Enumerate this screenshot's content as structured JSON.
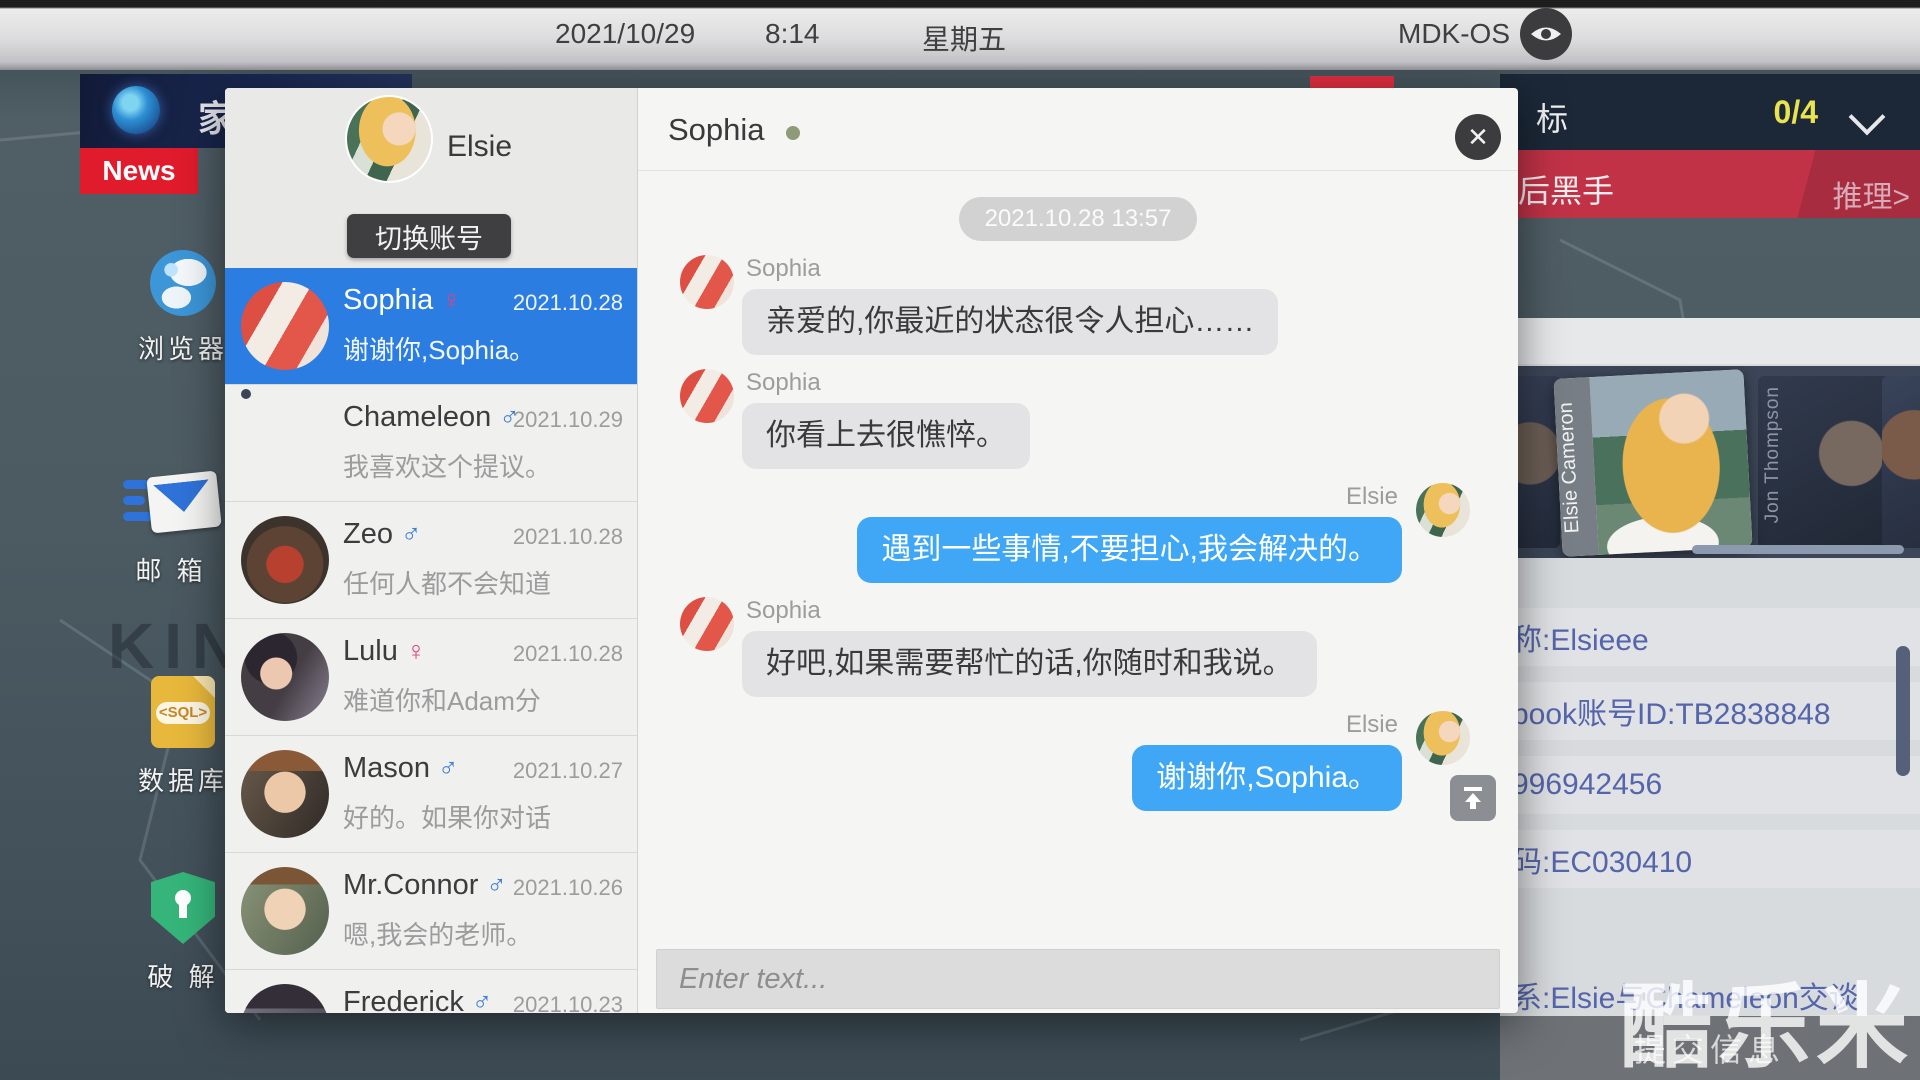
{
  "topbar": {
    "date": "2021/10/29",
    "time": "8:14",
    "weekday": "星期五",
    "os_name": "MDK-OS"
  },
  "desktop": {
    "news_widget": {
      "headline": "家",
      "badge": "News"
    },
    "wallpaper_text": "KIN S",
    "icons": [
      {
        "id": "browser",
        "label": "浏览器"
      },
      {
        "id": "mail",
        "label": "邮 箱"
      },
      {
        "id": "database",
        "label": "数据库",
        "badge": "<SQL>"
      },
      {
        "id": "crack",
        "label": "破 解"
      }
    ]
  },
  "messenger": {
    "account": {
      "name": "Elsie",
      "switch_button": "切换账号"
    },
    "contacts": [
      {
        "name": "Sophia",
        "gender": "♀",
        "date": "2021.10.28",
        "preview": "谢谢你,Sophia。"
      },
      {
        "name": "Chameleon",
        "gender": "♂",
        "date": "2021.10.29",
        "preview": "我喜欢这个提议。"
      },
      {
        "name": "Zeo",
        "gender": "♂",
        "date": "2021.10.28",
        "preview": "任何人都不会知道"
      },
      {
        "name": "Lulu",
        "gender": "♀",
        "date": "2021.10.28",
        "preview": "难道你和Adam分"
      },
      {
        "name": "Mason",
        "gender": "♂",
        "date": "2021.10.27",
        "preview": "好的。如果你对话"
      },
      {
        "name": "Mr.Connor",
        "gender": "♂",
        "date": "2021.10.26",
        "preview": "嗯,我会的老师。"
      },
      {
        "name": "Frederick",
        "gender": "♂",
        "date": "2021.10.23",
        "preview": ""
      }
    ],
    "chat": {
      "title": "Sophia",
      "timestamp": "2021.10.28 13:57",
      "messages": [
        {
          "from": "Sophia",
          "text": "亲爱的,你最近的状态很令人担心……"
        },
        {
          "from": "Sophia",
          "text": "你看上去很憔悴。"
        },
        {
          "from": "Elsie",
          "text": "遇到一些事情,不要担心,我会解决的。"
        },
        {
          "from": "Sophia",
          "text": "好吧,如果需要帮忙的话,你随时和我说。"
        },
        {
          "from": "Elsie",
          "text": "谢谢你,Sophia。"
        }
      ],
      "input_placeholder": "Enter text..."
    }
  },
  "mission_panel": {
    "objective_partial": "标",
    "progress": "0/4",
    "banner_partial": "后黑手",
    "deduce_label": "推理>",
    "cards": [
      {
        "name": "Elsie Cameron",
        "active": true
      },
      {
        "name": "Jon Thompson",
        "active": false
      }
    ],
    "clues": [
      "称:Elsieee",
      "book账号ID:TB2838848",
      "996942456",
      "码:EC030410"
    ],
    "relation": "系:Elsie与Chameleon交谈",
    "submit_button": "提交信息"
  },
  "watermark": "酷乐米",
  "colors": {
    "accent_blue_bubble": "#3fa7f6",
    "selected_contact": "#2b7de2",
    "progress_yellow": "#e8e34f",
    "banner_red": "#c13247",
    "clue_text": "#5565ab",
    "news_red": "#e01b2c"
  }
}
